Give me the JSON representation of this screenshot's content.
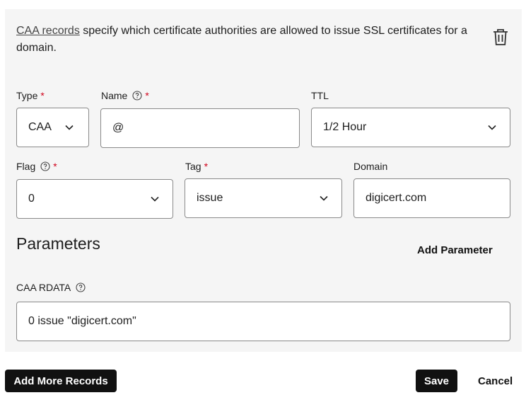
{
  "intro": {
    "link_text": "CAA records",
    "text": " specify which certificate authorities are allowed to issue SSL certificates for a domain."
  },
  "icons": {
    "delete": "trash-icon",
    "help": "question-circle-icon",
    "dropdown": "chevron-down-icon"
  },
  "fields": {
    "type": {
      "label": "Type",
      "required": "*",
      "value": "CAA"
    },
    "name": {
      "label": "Name",
      "required": "*",
      "value": "@"
    },
    "ttl": {
      "label": "TTL",
      "value": "1/2 Hour"
    },
    "flag": {
      "label": "Flag",
      "required": "*",
      "value": "0"
    },
    "tag": {
      "label": "Tag",
      "required": "*",
      "value": "issue"
    },
    "domain": {
      "label": "Domain",
      "value": "digicert.com"
    }
  },
  "parameters": {
    "title": "Parameters",
    "add_label": "Add Parameter"
  },
  "rdata": {
    "label": "CAA RDATA",
    "value": "0 issue \"digicert.com\""
  },
  "footer": {
    "add_more": "Add More Records",
    "save": "Save",
    "cancel": "Cancel"
  },
  "colors": {
    "required": "#d0021b",
    "panel_bg": "#f5f5f5",
    "primary_button": "#111111"
  }
}
